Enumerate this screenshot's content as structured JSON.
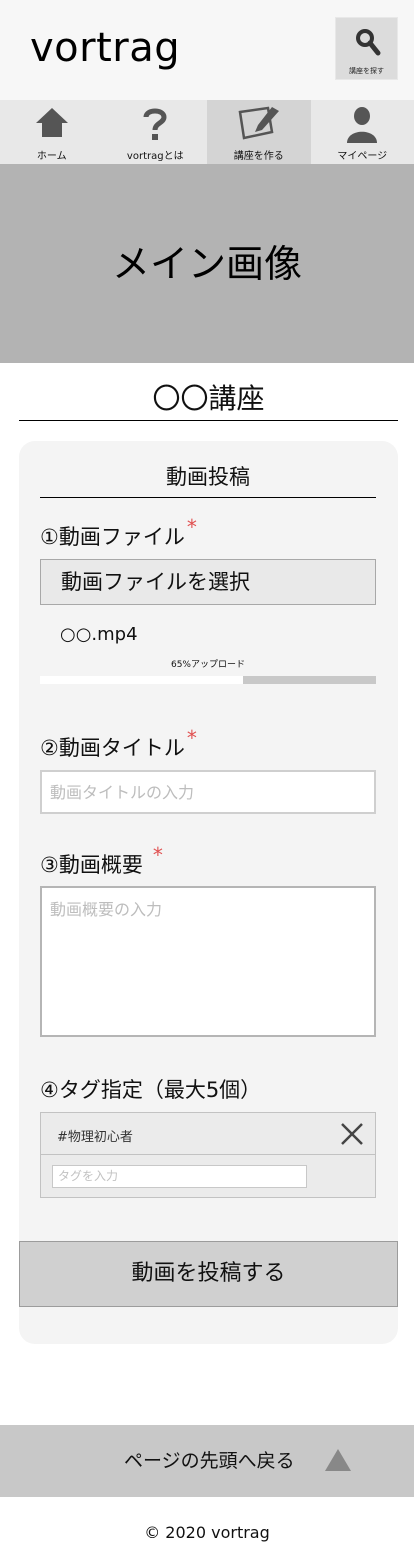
{
  "header": {
    "logo": "vortrag",
    "search_label": "講座を探す"
  },
  "nav": {
    "items": [
      {
        "label": "ホーム",
        "icon": "home-icon"
      },
      {
        "label": "vortragとは",
        "icon": "question-icon"
      },
      {
        "label": "講座を作る",
        "icon": "create-course-icon"
      },
      {
        "label": "マイページ",
        "icon": "user-icon"
      }
    ],
    "active_index": 2
  },
  "hero": {
    "text": "メイン画像"
  },
  "course": {
    "title": "〇〇講座"
  },
  "form": {
    "section_title": "動画投稿",
    "required_mark": "*",
    "file": {
      "label": "①動画ファイル",
      "button": "動画ファイルを選択",
      "file_name": "○○.mp4",
      "upload_status": "65%アップロード",
      "progress": 0.65
    },
    "title_field": {
      "label": "②動画タイトル",
      "placeholder": "動画タイトルの入力"
    },
    "description": {
      "label": "③動画概要",
      "placeholder": "動画概要の入力"
    },
    "tags": {
      "label": "④タグ指定（最大5個）",
      "items": [
        "#物理初心者"
      ],
      "placeholder": "タグを入力"
    },
    "submit": "動画を投稿する"
  },
  "footer": {
    "back_to_top": "ページの先頭へ戻る",
    "copyright": "© 2020 vortrag"
  },
  "colors": {
    "header_bg": "#f7f7f7",
    "nav_bg": "#e8e8e8",
    "hero_bg": "#b3b3b3",
    "card_bg": "#f4f4f4",
    "required": "#e05050",
    "footer_bg": "#c8c8c8"
  }
}
